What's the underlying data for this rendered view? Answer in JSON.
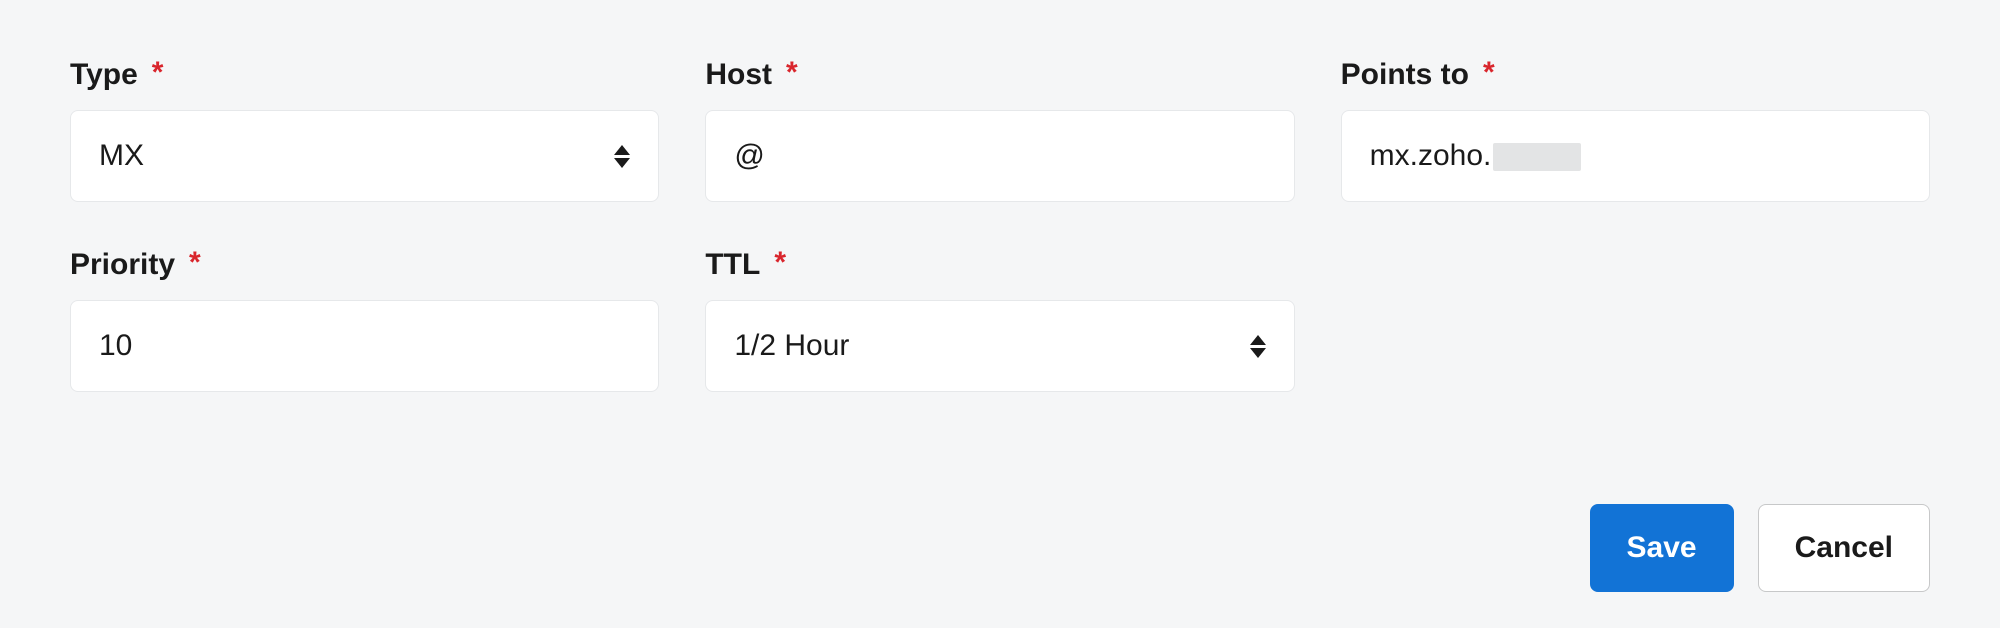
{
  "fields": {
    "type": {
      "label": "Type",
      "required": true,
      "value": "MX"
    },
    "host": {
      "label": "Host",
      "required": true,
      "value": "@"
    },
    "points_to": {
      "label": "Points to",
      "required": true,
      "value": "mx.zoho."
    },
    "priority": {
      "label": "Priority",
      "required": true,
      "value": "10"
    },
    "ttl": {
      "label": "TTL",
      "required": true,
      "value": "1/2 Hour"
    }
  },
  "buttons": {
    "save": "Save",
    "cancel": "Cancel"
  },
  "required_mark": "*"
}
